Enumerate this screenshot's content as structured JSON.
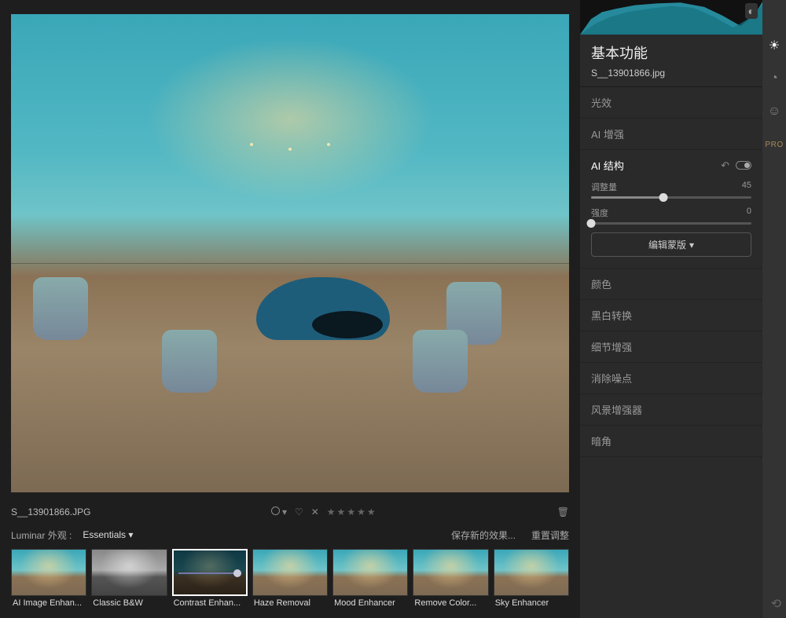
{
  "panel": {
    "title": "基本功能",
    "filename": "S__13901866.jpg",
    "sections": {
      "light": "光效",
      "ai_enhance": "AI 增强",
      "ai_structure": "AI 结构",
      "color": "颜色",
      "bw": "黑白转换",
      "detail": "细节增强",
      "denoise": "消除噪点",
      "landscape": "风景增强器",
      "vignette": "暗角"
    },
    "ai_structure": {
      "amount_label": "调整量",
      "amount_value": "45",
      "amount_pct": 45,
      "boost_label": "强度",
      "boost_value": "0",
      "boost_pct": 0,
      "mask_button": "编辑蒙版"
    }
  },
  "underbar": {
    "filename": "S__13901866.JPG"
  },
  "looks": {
    "prefix": "Luminar 外观 :",
    "category": "Essentials",
    "save_new": "保存新的效果...",
    "reset": "重置调整"
  },
  "thumbs": [
    {
      "label": "AI Image Enhan...",
      "style": "t-normal"
    },
    {
      "label": "Classic B&W",
      "style": "t-bw"
    },
    {
      "label": "Contrast Enhan...",
      "style": "t-dark",
      "selected": true,
      "slider": true
    },
    {
      "label": "Haze Removal",
      "style": "t-normal"
    },
    {
      "label": "Mood Enhancer",
      "style": "t-normal"
    },
    {
      "label": "Remove Color...",
      "style": "t-normal"
    },
    {
      "label": "Sky Enhancer",
      "style": "t-normal"
    }
  ],
  "rail": {
    "pro_label": "PRO"
  }
}
